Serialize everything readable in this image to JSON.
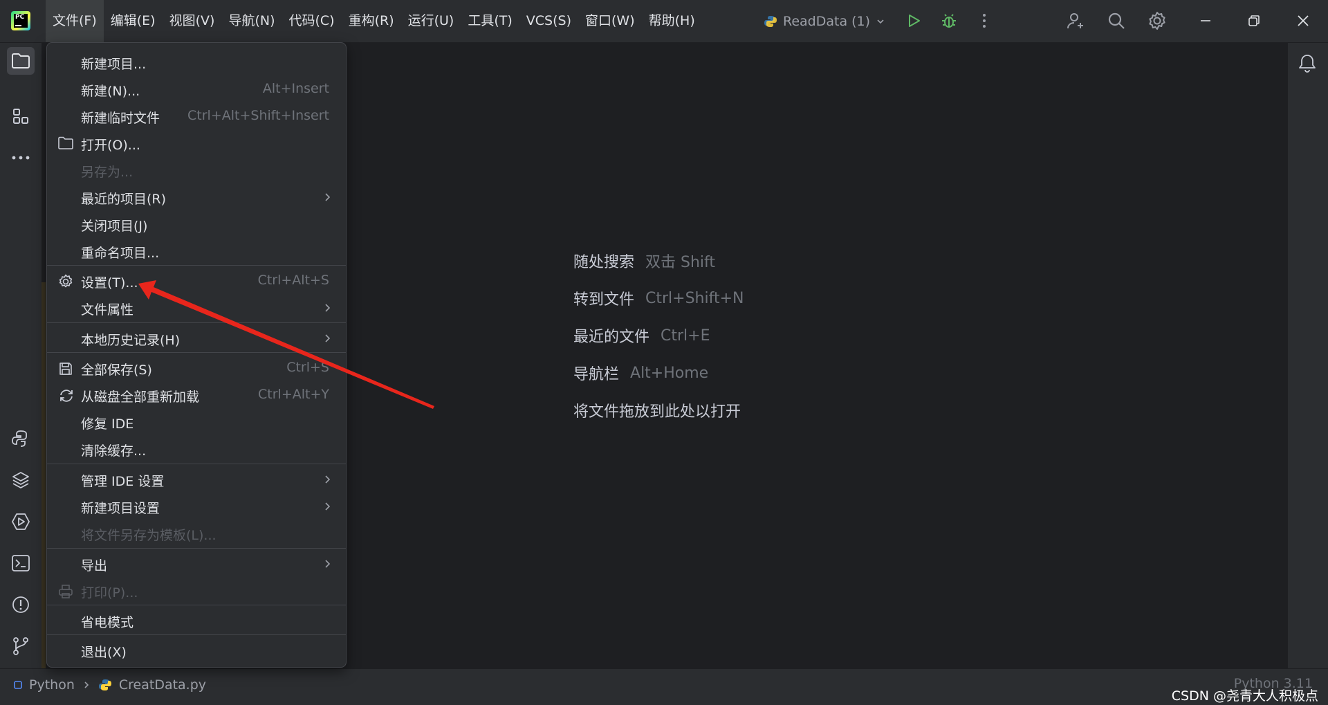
{
  "menubar": {
    "items": [
      {
        "label": "文件(F)",
        "active": true
      },
      {
        "label": "编辑(E)"
      },
      {
        "label": "视图(V)"
      },
      {
        "label": "导航(N)"
      },
      {
        "label": "代码(C)"
      },
      {
        "label": "重构(R)"
      },
      {
        "label": "运行(U)"
      },
      {
        "label": "工具(T)"
      },
      {
        "label": "VCS(S)"
      },
      {
        "label": "窗口(W)"
      },
      {
        "label": "帮助(H)"
      }
    ]
  },
  "toolbar": {
    "run_config": "ReadData (1)",
    "icons": [
      "run-icon",
      "debug-icon",
      "more-vertical-icon",
      "add-user-icon",
      "search-icon",
      "settings-icon"
    ],
    "window_controls": [
      "minimize-icon",
      "restore-icon",
      "close-icon"
    ]
  },
  "file_menu": {
    "items": [
      {
        "label": "新建项目...",
        "shortcut": ""
      },
      {
        "label": "新建(N)...",
        "shortcut": "Alt+Insert"
      },
      {
        "label": "新建临时文件",
        "shortcut": "Ctrl+Alt+Shift+Insert"
      },
      {
        "label": "打开(O)...",
        "shortcut": "",
        "icon": "folder-icon"
      },
      {
        "label": "另存为...",
        "shortcut": "",
        "disabled": true
      },
      {
        "label": "最近的项目(R)",
        "submenu": true
      },
      {
        "label": "关闭项目(J)"
      },
      {
        "label": "重命名项目..."
      },
      {
        "label": "设置(T)...",
        "shortcut": "Ctrl+Alt+S",
        "icon": "gear-icon"
      },
      {
        "label": "文件属性",
        "submenu": true
      },
      {
        "label": "本地历史记录(H)",
        "submenu": true
      },
      {
        "label": "全部保存(S)",
        "shortcut": "Ctrl+S",
        "icon": "save-icon"
      },
      {
        "label": "从磁盘全部重新加载",
        "shortcut": "Ctrl+Alt+Y",
        "icon": "reload-icon"
      },
      {
        "label": "修复 IDE"
      },
      {
        "label": "清除缓存..."
      },
      {
        "label": "管理 IDE 设置",
        "submenu": true
      },
      {
        "label": "新建项目设置",
        "submenu": true
      },
      {
        "label": "将文件另存为模板(L)...",
        "disabled": true
      },
      {
        "label": "导出",
        "submenu": true
      },
      {
        "label": "打印(P)...",
        "disabled": true,
        "icon": "print-icon"
      },
      {
        "label": "省电模式"
      },
      {
        "label": "退出(X)"
      }
    ]
  },
  "editor_hints": [
    {
      "label": "随处搜索",
      "shortcut": "双击 Shift"
    },
    {
      "label": "转到文件",
      "shortcut": "Ctrl+Shift+N"
    },
    {
      "label": "最近的文件",
      "shortcut": "Ctrl+E"
    },
    {
      "label": "导航栏",
      "shortcut": "Alt+Home"
    },
    {
      "label": "将文件拖放到此处以打开",
      "shortcut": ""
    }
  ],
  "statusbar": {
    "breadcrumb": [
      "Python",
      "CreatData.py"
    ],
    "interpreter": "Python 3.11"
  },
  "watermark": "CSDN @尧青大人积极点",
  "colors": {
    "accent_arrow": "#e8261c",
    "background": "#1e1f22",
    "panel": "#2b2d30",
    "run_green": "#5fb865"
  }
}
